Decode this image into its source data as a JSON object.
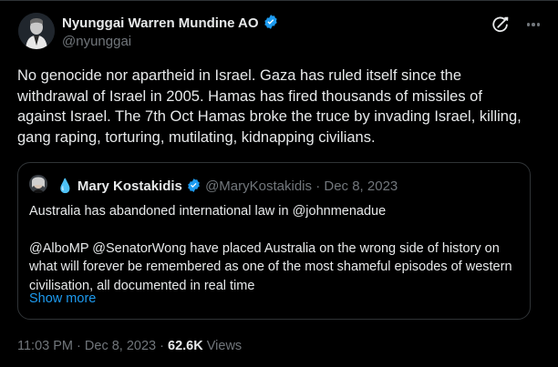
{
  "tweet": {
    "author_name": "Nyunggai Warren Mundine AO",
    "author_handle": "@nyunggai",
    "text": "No genocide nor apartheid in  Israel. Gaza has ruled itself since the\nwithdrawal of Israel in 2005. Hamas has fired thousands of missiles of\nagainst Israel. The 7th Oct Hamas broke the truce by invading Israel, killing,\ngang raping, torturing, mutilating, kidnapping civilians.",
    "time": "11:03 PM",
    "date": "Dec 8, 2023",
    "separator": "·",
    "views_count": "62.6K",
    "views_label": "Views"
  },
  "quote": {
    "author_emoji": "💧",
    "author_name": "Mary Kostakidis",
    "author_handle": "@MaryKostakidis",
    "separator": "·",
    "date": "Dec 8, 2023",
    "line1": "Australia has abandoned international law in @johnmenadue",
    "line2": "@AlboMP @SenatorWong have placed Australia on the wrong side of history on what will forever be remembered as one of the most shameful episodes of western civilisation, all documented in real time",
    "show_more": "Show more"
  },
  "colors": {
    "background": "#000000",
    "text": "#e7e9ea",
    "secondary": "#71767b",
    "accent": "#1d9bf0",
    "border": "#2f3336"
  },
  "icons": {
    "verified": "verified-badge-icon",
    "grok": "grok-icon",
    "more": "more-options-icon"
  }
}
